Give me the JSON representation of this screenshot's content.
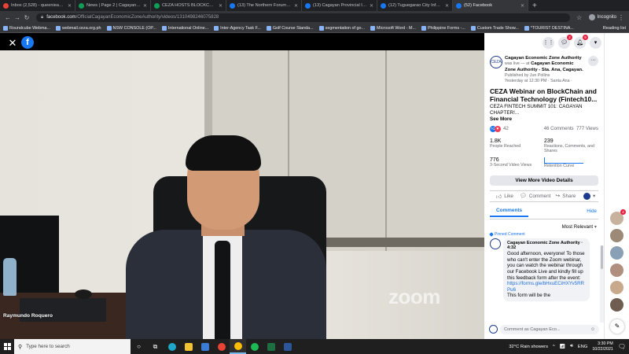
{
  "browser": {
    "tabs": [
      {
        "title": "Inbox (2,528) - queenieanne.ca...",
        "icon": "gmail-icon",
        "active": false
      },
      {
        "title": "News | Page 2 | Cagayan Econo...",
        "icon": "news-favicon-icon",
        "active": false
      },
      {
        "title": "CEZA HOSTS BLOCKCHAIN, FIN...",
        "icon": "news-favicon-icon",
        "active": false
      },
      {
        "title": "(13) The Northern Forum - Caga...",
        "icon": "facebook-icon",
        "active": false
      },
      {
        "title": "(13) Cagayan Provincial Informa...",
        "icon": "facebook-icon",
        "active": false
      },
      {
        "title": "(12) Tuguegarao City Informatio...",
        "icon": "facebook-icon",
        "active": false
      },
      {
        "title": "(52) Facebook",
        "icon": "facebook-icon",
        "active": true
      }
    ],
    "url_host": "facebook.com",
    "url_path": "/OfficialCagayanEconomicZoneAuthority/videos/1310498246075828",
    "incognito_label": "Incognito",
    "bookmarks": [
      "Roundcube Webma...",
      "webmail.ceza.org.ph",
      "NSW CONSOLE (OP...",
      "International Online...",
      "Inter-Agency Task F...",
      "Golf Course Standa...",
      "segmentation of go...",
      "Microsoft Word - M...",
      "Philippine Forms -...",
      "Custom Trade Show...",
      "*TOURIST DESTINA..."
    ],
    "reading_list": "Reading list"
  },
  "video": {
    "speaker_name": "Raymundo Roquero",
    "watermark": "zoom"
  },
  "topbar": {
    "messenger_badge": "2",
    "notifications_badge": "9"
  },
  "post": {
    "line1": "Cagayan Economic Zone Authority",
    "line2": "was live — at",
    "line3": "Cagayan Economic Zone Authority - Sta. Ana, Cagayan.",
    "published_by": "Published by Jun Pollins",
    "timestamp": "Yesterday at 12:30 PM · Santa Ana ·",
    "title": "CEZA Webinar on BlockChain and Financial Technology (Fintech10...",
    "body": "CEZA FINTECH SUMMIT 101: CAGAYAN CHAPTER!...",
    "see_more": "See More",
    "reaction_count": "42",
    "comments_count": "46 Comments",
    "views_count": "777 Views",
    "stats": [
      {
        "value": "1.8K",
        "label": "People Reached"
      },
      {
        "value": "239",
        "label": "Reactions, Comments, and Shares"
      },
      {
        "value": "776",
        "label": "3-Second Video Views"
      },
      {
        "value": "",
        "label": "Retention Curve"
      }
    ],
    "view_more_btn": "View More Video Details",
    "actions": {
      "like": "Like",
      "comment": "Comment",
      "share": "Share"
    }
  },
  "comments": {
    "tab_label": "Comments",
    "hide_label": "Hide",
    "sort_label": "Most Relevant",
    "pinned_label": "Pinned Comment",
    "items": [
      {
        "author": "Cagayan Economic Zone Authority",
        "badge": "· 4:32",
        "text": "Good afternoon, everyone! To those who can't enter the Zoom webinar, you can watch the webinar through our Facebook Live and kindly fill up this feedback form after the event:",
        "link": "https://forms.gle/bHxuECiHXYv5RRPu6",
        "tail": "This form will be the"
      }
    ],
    "compose_placeholder": "Comment as Cagayan Eco..."
  },
  "rail": {
    "first_badge": "4"
  },
  "taskbar": {
    "search_placeholder": "Type here to search",
    "weather": "32°C  Rain showers",
    "lang": "ENG",
    "time": "3:30 PM",
    "date": "10/22/2021"
  }
}
